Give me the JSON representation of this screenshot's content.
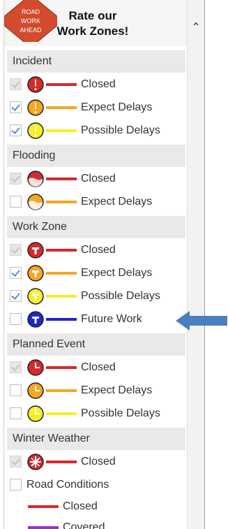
{
  "header": {
    "sign_text": [
      "ROAD",
      "WORK",
      "AHEAD"
    ],
    "title_line1": "Rate our",
    "title_line2": "Work Zones!"
  },
  "sections": [
    {
      "title": "Incident",
      "rows": [
        {
          "icon": "incident-icon",
          "state": "disabled",
          "color": "#d32b2b",
          "label": "Closed"
        },
        {
          "icon": "incident-icon",
          "state": "checked",
          "color": "#f5a623",
          "label": "Expect Delays"
        },
        {
          "icon": "incident-icon",
          "state": "checked",
          "color": "#f7ee2a",
          "label": "Possible Delays"
        }
      ]
    },
    {
      "title": "Flooding",
      "rows": [
        {
          "icon": "flooding-icon",
          "state": "disabled",
          "color": "#d32b2b",
          "label": "Closed"
        },
        {
          "icon": "flooding-icon",
          "state": "unchecked",
          "color": "#f5a623",
          "label": "Expect Delays"
        }
      ]
    },
    {
      "title": "Work Zone",
      "rows": [
        {
          "icon": "work-zone-icon",
          "state": "disabled",
          "color": "#d32b2b",
          "label": "Closed"
        },
        {
          "icon": "work-zone-icon",
          "state": "checked",
          "color": "#f5a623",
          "label": "Expect Delays"
        },
        {
          "icon": "work-zone-icon",
          "state": "checked",
          "color": "#f7ee2a",
          "label": "Possible Delays"
        },
        {
          "icon": "work-zone-icon",
          "state": "unchecked",
          "color": "#1f27c8",
          "label": "Future Work"
        }
      ]
    },
    {
      "title": "Planned Event",
      "rows": [
        {
          "icon": "planned-event-icon",
          "state": "disabled",
          "color": "#d32b2b",
          "label": "Closed"
        },
        {
          "icon": "planned-event-icon",
          "state": "unchecked",
          "color": "#f5a623",
          "label": "Expect Delays"
        },
        {
          "icon": "planned-event-icon",
          "state": "unchecked",
          "color": "#f7ee2a",
          "label": "Possible Delays"
        }
      ]
    },
    {
      "title": "Winter Weather",
      "rows": [
        {
          "icon": "winter-weather-icon",
          "state": "disabled",
          "color": "#d32b2b",
          "label": "Closed"
        }
      ]
    }
  ],
  "road_conditions": {
    "label": "Road Conditions",
    "items": [
      {
        "color": "#d32b2b",
        "label": "Closed"
      },
      {
        "color": "#9b2fd0",
        "label": "Covered"
      }
    ]
  },
  "colors": {
    "red": "#d32b2b",
    "orange": "#f5a623",
    "yellow": "#f7ee2a",
    "blue": "#1f27c8",
    "purple": "#9b2fd0",
    "arrow": "#4a7fc1"
  }
}
